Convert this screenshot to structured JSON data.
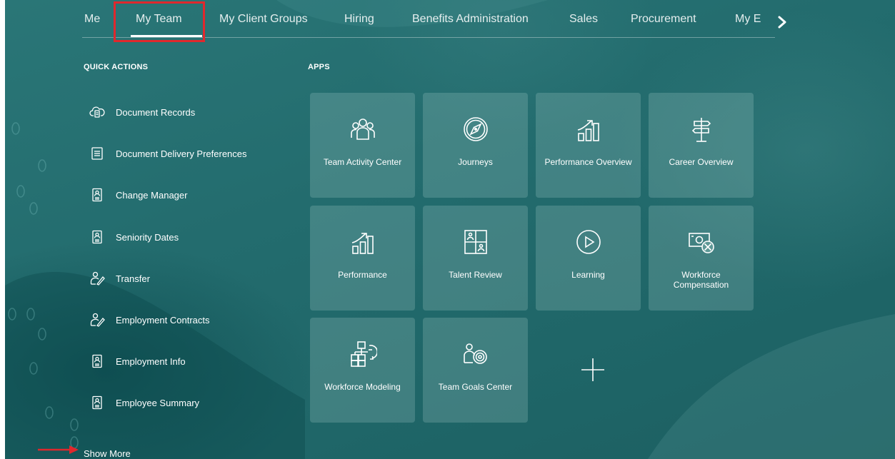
{
  "nav": {
    "tabs": [
      {
        "label": "Me",
        "active": false
      },
      {
        "label": "My Team",
        "active": true
      },
      {
        "label": "My Client Groups",
        "active": false
      },
      {
        "label": "Hiring",
        "active": false
      },
      {
        "label": "Benefits Administration",
        "active": false
      },
      {
        "label": "Sales",
        "active": false
      },
      {
        "label": "Procurement",
        "active": false
      },
      {
        "label": "My E",
        "active": false
      }
    ],
    "next_icon": "chevron-right-icon"
  },
  "quick_actions": {
    "title": "QUICK ACTIONS",
    "items": [
      {
        "label": "Document Records",
        "icon": "cloud-document-icon"
      },
      {
        "label": "Document Delivery Preferences",
        "icon": "document-list-icon"
      },
      {
        "label": "Change Manager",
        "icon": "person-badge-icon"
      },
      {
        "label": "Seniority Dates",
        "icon": "person-badge-icon"
      },
      {
        "label": "Transfer",
        "icon": "person-transfer-icon"
      },
      {
        "label": "Employment Contracts",
        "icon": "person-transfer-icon"
      },
      {
        "label": "Employment Info",
        "icon": "person-badge-icon"
      },
      {
        "label": "Employee Summary",
        "icon": "person-badge-icon"
      }
    ],
    "show_more": "Show More"
  },
  "apps": {
    "title": "APPS",
    "tiles": [
      {
        "label": "Team Activity Center",
        "icon": "team-icon"
      },
      {
        "label": "Journeys",
        "icon": "compass-icon"
      },
      {
        "label": "Performance Overview",
        "icon": "growth-chart-icon"
      },
      {
        "label": "Career Overview",
        "icon": "signpost-icon"
      },
      {
        "label": "Performance",
        "icon": "growth-chart-icon"
      },
      {
        "label": "Talent Review",
        "icon": "talent-grid-icon"
      },
      {
        "label": "Learning",
        "icon": "play-circle-icon"
      },
      {
        "label": "Workforce Compensation",
        "icon": "money-icon"
      },
      {
        "label": "Workforce Modeling",
        "icon": "org-model-icon"
      },
      {
        "label": "Team Goals Center",
        "icon": "goals-target-icon"
      }
    ],
    "add_icon": "plus-icon"
  },
  "colors": {
    "background": "#236c6e",
    "tile": "#5e9896",
    "highlight": "#e0282d",
    "text": "#ffffff"
  }
}
